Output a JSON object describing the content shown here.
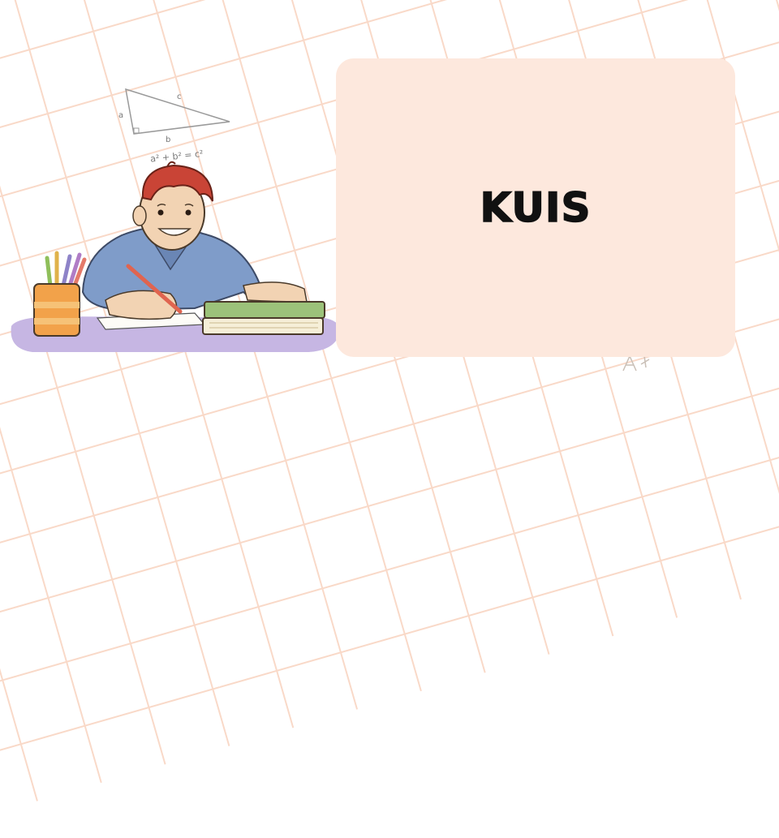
{
  "slide": {
    "title": "KUIS",
    "colors": {
      "grid_lines": "#f9d9c8",
      "card_background": "#fde8dd",
      "title_text": "#111111"
    }
  },
  "illustration": {
    "icon": "student-studying-illustration",
    "triangle_labels": {
      "a": "a",
      "b": "b",
      "c": "c"
    },
    "formula": "a² + b² = c²"
  }
}
